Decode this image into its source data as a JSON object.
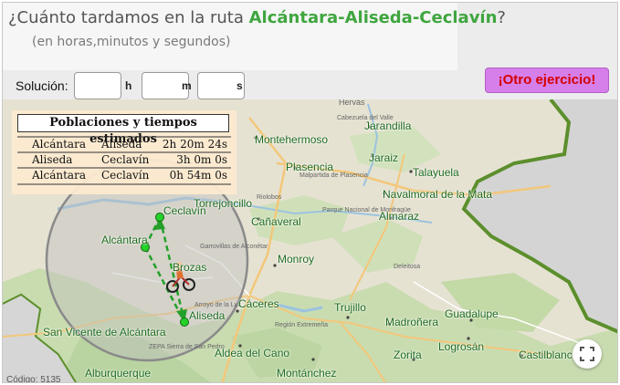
{
  "header": {
    "question_prefix": "¿Cuánto tardamos en la ruta ",
    "question_route": "Alcántara-Aliseda-Ceclavín",
    "question_suffix": "?",
    "subtitle": "(en horas,minutos y segundos)"
  },
  "answer": {
    "label": "Solución:",
    "hours_value": "",
    "minutes_value": "",
    "seconds_value": "",
    "hours_unit": "h",
    "minutes_unit": "m",
    "seconds_unit": "s"
  },
  "new_exercise_label": "¡Otro ejercicio!",
  "table": {
    "title": "Poblaciones y tiempos estimados",
    "rows": [
      {
        "from": "Alcántara",
        "to": "Aliseda",
        "time": "2h 20m 24s"
      },
      {
        "from": "Aliseda",
        "to": "Ceclavín",
        "time": "3h 0m 0s"
      },
      {
        "from": "Alcántara",
        "to": "Ceclavín",
        "time": "0h 54m 0s"
      }
    ]
  },
  "map": {
    "route_towns": {
      "ceclavin": "Ceclavín",
      "alcantara": "Alcántara",
      "aliseda": "Aliseda",
      "brozas": "Brozas"
    },
    "towns": {
      "jarandilla": "Jarandilla",
      "montehermoso": "Montehermoso",
      "plasencia": "Plasencia",
      "jaraiz": "Jaraiz",
      "talayuela": "Talayuela",
      "torrejoncillo": "Torrejoncillo",
      "navalmoral": "Navalmoral de la Mata",
      "canaveral": "Cañaveral",
      "almaraz": "Almaraz",
      "monroy": "Monroy",
      "caceres": "Cáceres",
      "trujillo": "Trujillo",
      "guadalupe": "Guadalupe",
      "madronera": "Madroñera",
      "san_vicente": "San Vicente de Alcántara",
      "aldea_del_cano": "Aldea del Cano",
      "logrosan": "Logrosán",
      "zorita": "Zorita",
      "castilblanco": "Castilblanco",
      "alburquerque": "Alburquerque",
      "montanchez": "Montánchez"
    },
    "small_labels": {
      "hervas": "Hervás",
      "cabezuela": "Cabezuela del Valle",
      "malpartida": "Malpartida de Plasencia",
      "riolobos": "Riolobos",
      "garrovillas": "Garrovillas de Alconétar",
      "arroyo": "Arroyo de la Luz",
      "parque": "Parque Nacional de Monfragüe",
      "deleitosa": "Deleitosa",
      "zepa": "ZEPA Sierra de San Pedro",
      "region": "Región Extremeña"
    },
    "code_label": "Código: 5135",
    "colors": {
      "route": "#24a02a",
      "town_text": "#1e6b1e",
      "button_bg": "#d67fea",
      "button_text": "#d40000",
      "table_bg": "#fceade"
    }
  }
}
